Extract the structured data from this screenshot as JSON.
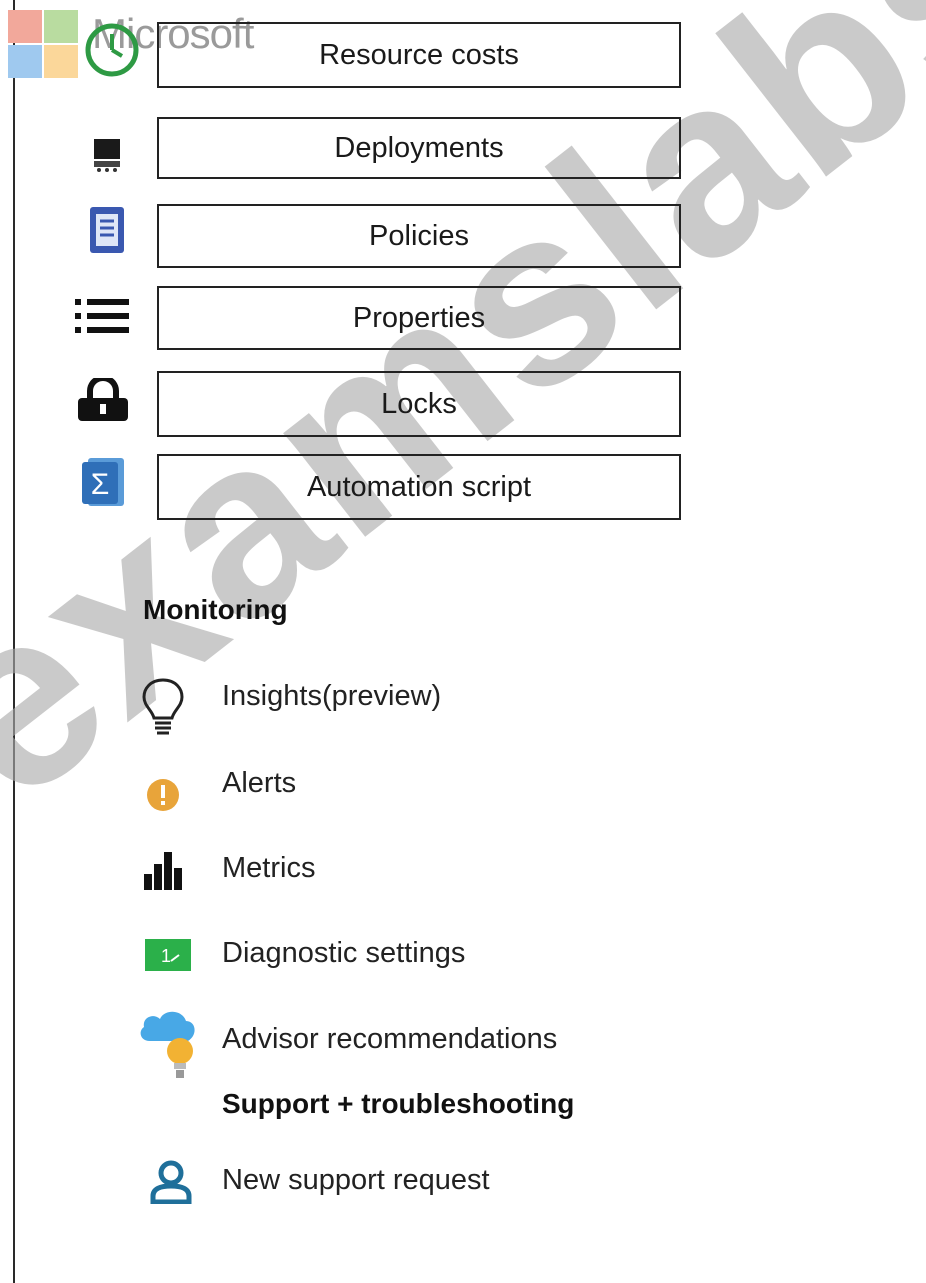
{
  "brand": {
    "name": "Microsoft"
  },
  "watermark": {
    "text": "examslabs.co"
  },
  "resource_menu": [
    {
      "label": "Resource costs",
      "icon": "clock-icon"
    },
    {
      "label": "Deployments",
      "icon": "deployments-icon"
    },
    {
      "label": "Policies",
      "icon": "policies-icon"
    },
    {
      "label": "Properties",
      "icon": "properties-list-icon"
    },
    {
      "label": "Locks",
      "icon": "lock-icon"
    },
    {
      "label": "Automation script",
      "icon": "automation-script-icon"
    }
  ],
  "monitoring": {
    "heading": "Monitoring",
    "items": [
      {
        "label": "Insights(preview)",
        "icon": "lightbulb-icon"
      },
      {
        "label": "Alerts",
        "icon": "alert-icon"
      },
      {
        "label": "Metrics",
        "icon": "metrics-bar-icon"
      },
      {
        "label": "Diagnostic settings",
        "icon": "diagnostic-settings-icon"
      },
      {
        "label": "Advisor recommendations",
        "icon": "advisor-cloud-icon"
      }
    ]
  },
  "support": {
    "heading": "Support + troubleshooting",
    "items": [
      {
        "label": "New support request",
        "icon": "user-support-icon"
      }
    ]
  },
  "colors": {
    "border": "#222222",
    "accent_blue": "#3a6fb6",
    "alert_orange": "#e8a43a",
    "diag_green": "#2bb04a",
    "support_teal": "#1f6f9a"
  }
}
